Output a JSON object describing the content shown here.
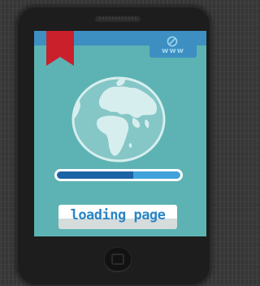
{
  "device": {
    "type": "tablet"
  },
  "screen": {
    "background_color": "#5db3b3",
    "topbar_color": "#3d8fc2",
    "bookmark": {
      "icon": "bookmark-icon",
      "color": "#c9202c"
    },
    "web_button": {
      "icon": "ban-icon",
      "label": "www"
    },
    "globe": {
      "icon": "globe-icon"
    },
    "progress": {
      "value": 0.62,
      "fill_color": "#1a63a5",
      "track_color": "#3fa2da"
    },
    "loading_button": {
      "label": "loading page",
      "text_color": "#2a86c6"
    }
  }
}
